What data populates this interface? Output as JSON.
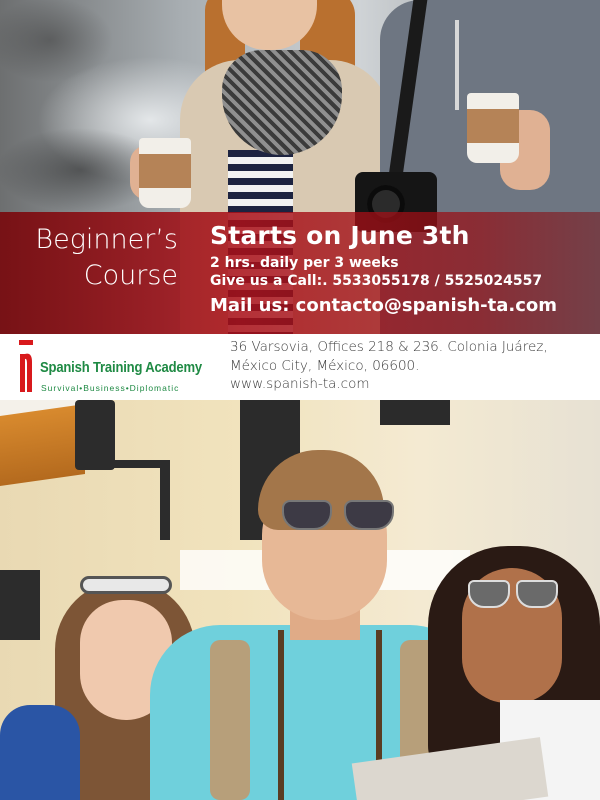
{
  "banner": {
    "course_title_line1": "Beginner’s",
    "course_title_line2": "Course",
    "starts": "Starts on June  3th",
    "schedule": "2 hrs. daily per 3 weeks",
    "call": "Give us a Call:. 5533055178 / 5525024557",
    "mail": "Mail us: contacto@spanish-ta.com"
  },
  "academy": {
    "name": "Spanish Training Academy",
    "tagline": "Survival•Business•Diplomatic",
    "address_line1": "36 Varsovia, Offices 218 & 236. Colonia Juárez,",
    "address_line2": "México City, México, 06600.",
    "website": "www.spanish-ta.com"
  },
  "colors": {
    "banner_red": "#aa1018",
    "logo_green": "#1f8a44",
    "logo_red": "#d8191c"
  },
  "images": {
    "top_photo": "couple-with-coffee-and-camera",
    "bottom_photo": "three-young-tourists-in-city"
  }
}
